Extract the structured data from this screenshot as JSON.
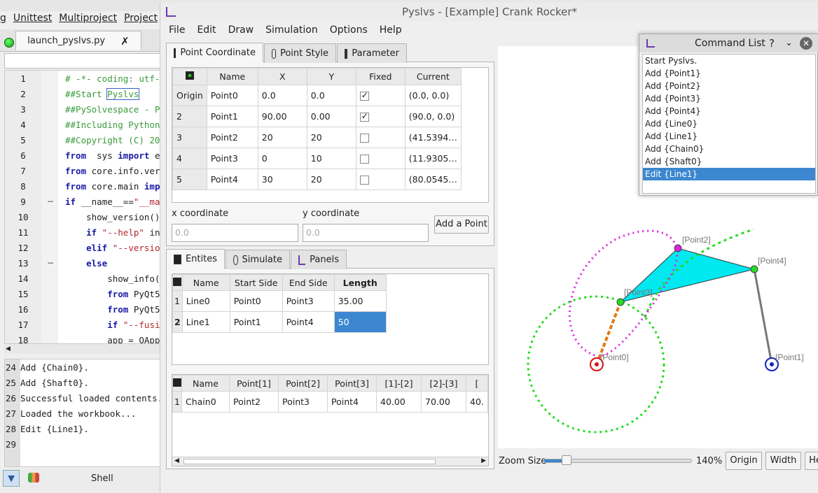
{
  "editor": {
    "menu": [
      "g",
      "Unittest",
      "Multiproject",
      "Project",
      "Ex"
    ],
    "file_tab": "launch_pyslvs.py",
    "close_glyph": "✗",
    "line_numbers": [
      "1",
      "2",
      "3",
      "4",
      "5",
      "6",
      "7",
      "8",
      "9",
      "10",
      "11",
      "12",
      "13",
      "14",
      "15",
      "16",
      "17",
      "18"
    ],
    "code": [
      {
        "segs": [
          [
            "cm",
            "# -*- coding: utf-8"
          ]
        ]
      },
      {
        "segs": [
          [
            "cm",
            "##Start "
          ],
          [
            "cmbox",
            "Pyslvs"
          ]
        ]
      },
      {
        "segs": [
          [
            "cm",
            "##PySolvespace - Py"
          ]
        ]
      },
      {
        "segs": [
          [
            "cm",
            "##Including Python"
          ]
        ]
      },
      {
        "segs": [
          [
            "cm",
            "##Copyright (C) 201"
          ]
        ]
      },
      {
        "segs": [
          [
            "kw",
            "from"
          ],
          [
            "",
            "  sys "
          ],
          [
            "kw",
            "import"
          ],
          [
            "",
            " exi"
          ]
        ]
      },
      {
        "segs": [
          [
            "kw",
            "from"
          ],
          [
            "",
            " core.info.vers"
          ]
        ]
      },
      {
        "segs": [
          [
            "kw",
            "from"
          ],
          [
            "",
            " core.main "
          ],
          [
            "kw",
            "impo"
          ]
        ]
      },
      {
        "segs": [
          [
            "kw",
            "if"
          ],
          [
            "",
            " __name__=="
          ],
          [
            "st",
            "\"__mai"
          ]
        ]
      },
      {
        "segs": [
          [
            "",
            "    show_version()"
          ]
        ]
      },
      {
        "segs": [
          [
            "",
            "    "
          ],
          [
            "kw",
            "if"
          ],
          [
            "",
            " "
          ],
          [
            "st",
            "\"--help\""
          ],
          [
            "",
            " in"
          ]
        ]
      },
      {
        "segs": [
          [
            "",
            "    "
          ],
          [
            "kw",
            "elif"
          ],
          [
            "",
            " "
          ],
          [
            "st",
            "\"--version"
          ]
        ]
      },
      {
        "segs": [
          [
            "",
            "    "
          ],
          [
            "kw",
            "else"
          ],
          [
            ":"
          ]
        ]
      },
      {
        "segs": [
          [
            "",
            "        show_info()"
          ]
        ]
      },
      {
        "segs": [
          [
            "",
            "        "
          ],
          [
            "kw",
            "from"
          ],
          [
            "",
            " PyQt5."
          ]
        ]
      },
      {
        "segs": [
          [
            "",
            "        "
          ],
          [
            "kw",
            "from"
          ],
          [
            "",
            " PyQt5."
          ]
        ]
      },
      {
        "segs": [
          [
            "",
            "        "
          ],
          [
            "kw",
            "if"
          ],
          [
            "",
            " "
          ],
          [
            "st",
            "\"--fusic"
          ]
        ]
      },
      {
        "segs": [
          [
            "",
            "        app = QAppl"
          ]
        ]
      }
    ],
    "shell_numbers": [
      "24",
      "25",
      "26",
      "27",
      "28",
      "29"
    ],
    "shell_lines": [
      "Add {Chain0}.",
      "Add {Shaft0}.",
      "Successful loaded contents.",
      "Loaded the workbook...",
      "Edit {Line1}.",
      ""
    ],
    "shell_label": "Shell"
  },
  "main": {
    "title": "Pyslvs - [Example] Crank Rocker*",
    "menu": [
      "File",
      "Edit",
      "Draw",
      "Simulation",
      "Options",
      "Help"
    ],
    "top_tabs": [
      "Point Coordinate",
      "Point Style",
      "Parameter"
    ],
    "points_headers": [
      "Name",
      "X",
      "Y",
      "Fixed",
      "Current"
    ],
    "points_rows": [
      {
        "row": "Origin",
        "name": "Point0",
        "x": "0.0",
        "y": "0.0",
        "fixed": true,
        "current": "(0.0, 0.0)"
      },
      {
        "row": "2",
        "name": "Point1",
        "x": "90.00",
        "y": "0.00",
        "fixed": true,
        "current": "(90.0, 0.0)"
      },
      {
        "row": "3",
        "name": "Point2",
        "x": "20",
        "y": "20",
        "fixed": false,
        "current": "(41.5394…"
      },
      {
        "row": "4",
        "name": "Point3",
        "x": "0",
        "y": "10",
        "fixed": false,
        "current": "(11.9305…"
      },
      {
        "row": "5",
        "name": "Point4",
        "x": "30",
        "y": "20",
        "fixed": false,
        "current": "(80.0545…"
      }
    ],
    "x_label": "x coordinate",
    "y_label": "y coordinate",
    "x_placeholder": "0.0",
    "y_placeholder": "0.0",
    "add_point": "Add a Point",
    "bottom_tabs": [
      "Entites",
      "Simulate",
      "Panels"
    ],
    "lines_headers": [
      "Name",
      "Start Side",
      "End Side",
      "Length"
    ],
    "lines_rows": [
      {
        "row": "1",
        "name": "Line0",
        "start": "Point0",
        "end": "Point3",
        "length": "35.00"
      },
      {
        "row": "2",
        "name": "Line1",
        "start": "Point1",
        "end": "Point4",
        "length": "50"
      }
    ],
    "chain_headers": [
      "Name",
      "Point[1]",
      "Point[2]",
      "Point[3]",
      "[1]-[2]",
      "[2]-[3]",
      "["
    ],
    "chain_rows": [
      {
        "row": "1",
        "name": "Chain0",
        "p1": "Point2",
        "p2": "Point3",
        "p3": "Point4",
        "a": "40.00",
        "b": "70.00",
        "c": "40."
      }
    ],
    "canvas_labels": {
      "p0": "[Point0]",
      "p1": "[Point1]",
      "p2": "[Point2]",
      "p3": "[Point3]",
      "p4": "[Point4]"
    },
    "zoom_label": "Zoom Size",
    "zoom_percent": "140%",
    "zoom_value": 0.15,
    "buttons": [
      "Origin",
      "Width",
      "He"
    ]
  },
  "command_list": {
    "title": "Command List",
    "help_glyph": "?",
    "items": [
      "Start Pyslvs.",
      "Add {Point1}",
      "Add {Point2}",
      "Add {Point3}",
      "Add {Point4}",
      "Add {Line0}",
      "Add {Line1}",
      "Add {Chain0}",
      "Add {Shaft0}",
      "Edit {Line1}"
    ],
    "selected_index": 9
  },
  "colors": {
    "selection": "#3c87cf",
    "triangle": "#00e8f0",
    "path_green": "#22dd22",
    "path_magenta": "#dd22dd",
    "crank": "#e07b1a",
    "fixed_red": "#dd1111",
    "fixed_blue": "#1122bb"
  }
}
